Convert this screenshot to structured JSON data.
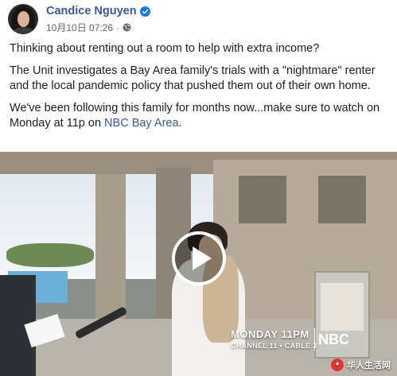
{
  "post": {
    "author": "Candice Nguyen",
    "date": "10月10日 07:26",
    "separator": "·",
    "paragraphs": {
      "p1": "Thinking about renting out a room to help with extra income?",
      "p2": "The Unit investigates a Bay Area family's trials with a \"nightmare\" renter and the local pandemic policy that pushed them out of their own home.",
      "p3_before": "We've been following this family for months now...make sure to watch on Monday at 11p on ",
      "p3_link": "NBC Bay Area",
      "p3_after": "."
    }
  },
  "video": {
    "broadcast_title": "MONDAY 11PM",
    "broadcast_sub": "CHANNEL 11 • CABLE 3",
    "logo_text": "NBC",
    "watermark": "华人生活网"
  },
  "colors": {
    "link": "#385898",
    "verified_badge": "#1877f2",
    "text": "#1c1e21",
    "meta": "#606770"
  },
  "icons": {
    "verified": "verified-badge-icon",
    "privacy": "globe-icon",
    "play": "play-icon",
    "watermark": "wechat-icon"
  }
}
